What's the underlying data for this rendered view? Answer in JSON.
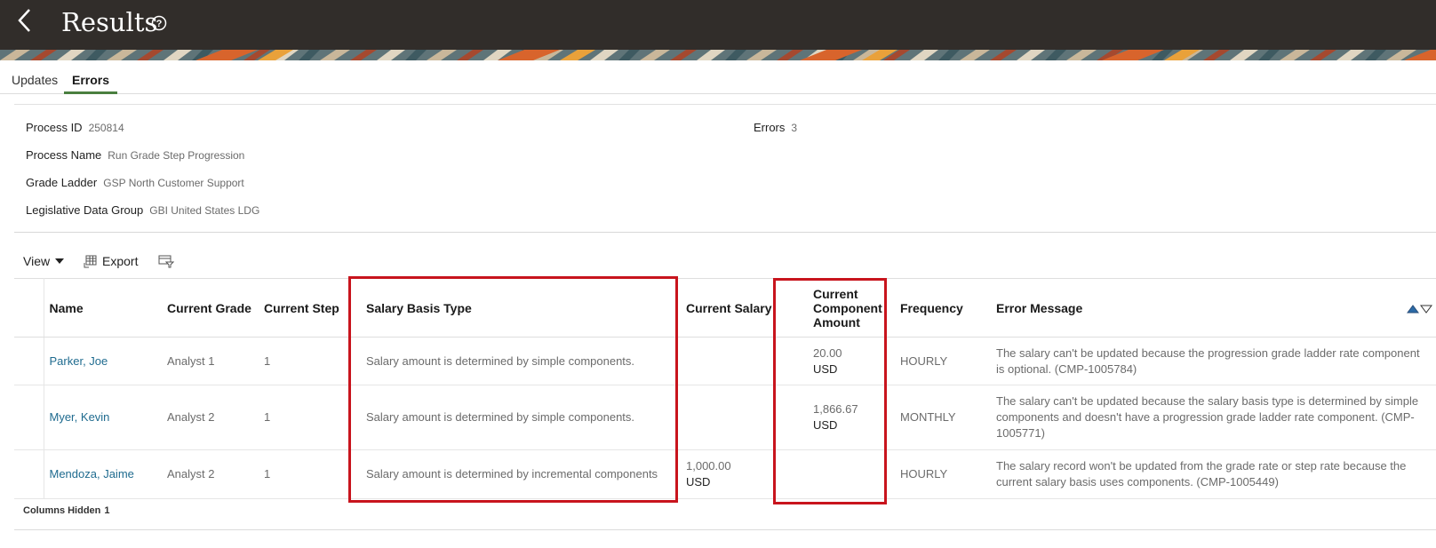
{
  "header": {
    "title": "Results",
    "back_icon": "chevron-left-icon",
    "help_icon": "question-circle-icon"
  },
  "tabs": [
    {
      "label": "Updates",
      "active": false
    },
    {
      "label": "Errors",
      "active": true
    }
  ],
  "summary": {
    "process_id": {
      "label": "Process ID",
      "value": "250814"
    },
    "process_name": {
      "label": "Process Name",
      "value": "Run Grade Step Progression"
    },
    "grade_ladder": {
      "label": "Grade Ladder",
      "value": "GSP North Customer Support"
    },
    "ldg": {
      "label": "Legislative Data Group",
      "value": "GBI United States LDG"
    },
    "errors": {
      "label": "Errors",
      "value": "3"
    }
  },
  "toolbar": {
    "view_label": "View",
    "export_label": "Export"
  },
  "table": {
    "columns": {
      "name": "Name",
      "current_grade": "Current Grade",
      "current_step": "Current Step",
      "salary_basis_type": "Salary Basis Type",
      "current_salary": "Current Salary",
      "current_component_amount_line1": "Current",
      "current_component_amount_line2": "Component",
      "current_component_amount_line3": "Amount",
      "frequency": "Frequency",
      "error_message": "Error Message"
    },
    "rows": [
      {
        "name": "Parker, Joe",
        "current_grade": "Analyst 1",
        "current_step": "1",
        "salary_basis_type": "Salary amount is determined by simple components.",
        "current_salary_amount": "",
        "current_salary_currency": "",
        "component_amount": "20.00",
        "component_currency": "USD",
        "frequency": "HOURLY",
        "error_message": "The salary can't be updated because the progression grade ladder rate component is optional. (CMP-1005784)"
      },
      {
        "name": "Myer, Kevin",
        "current_grade": "Analyst 2",
        "current_step": "1",
        "salary_basis_type": "Salary amount is determined by simple components.",
        "current_salary_amount": "",
        "current_salary_currency": "",
        "component_amount": "1,866.67",
        "component_currency": "USD",
        "frequency": "MONTHLY",
        "error_message": "The salary can't be updated because the salary basis type is determined by simple components and doesn't have a progression grade ladder rate component. (CMP-1005771)"
      },
      {
        "name": "Mendoza, Jaime",
        "current_grade": "Analyst 2",
        "current_step": "1",
        "salary_basis_type": "Salary amount is determined by incremental components",
        "current_salary_amount": "1,000.00",
        "current_salary_currency": "USD",
        "component_amount": "",
        "component_currency": "",
        "frequency": "HOURLY",
        "error_message": "The salary record won't be updated from the grade rate or step rate because the current salary basis uses components. (CMP-1005449)"
      }
    ]
  },
  "footer": {
    "columns_hidden_label": "Columns Hidden",
    "columns_hidden_count": "1"
  },
  "colors": {
    "header_bg": "#312d2a",
    "link": "#1f6b8f",
    "active_tab_underline": "#4a7f3f",
    "highlight_box": "#c8141d"
  }
}
